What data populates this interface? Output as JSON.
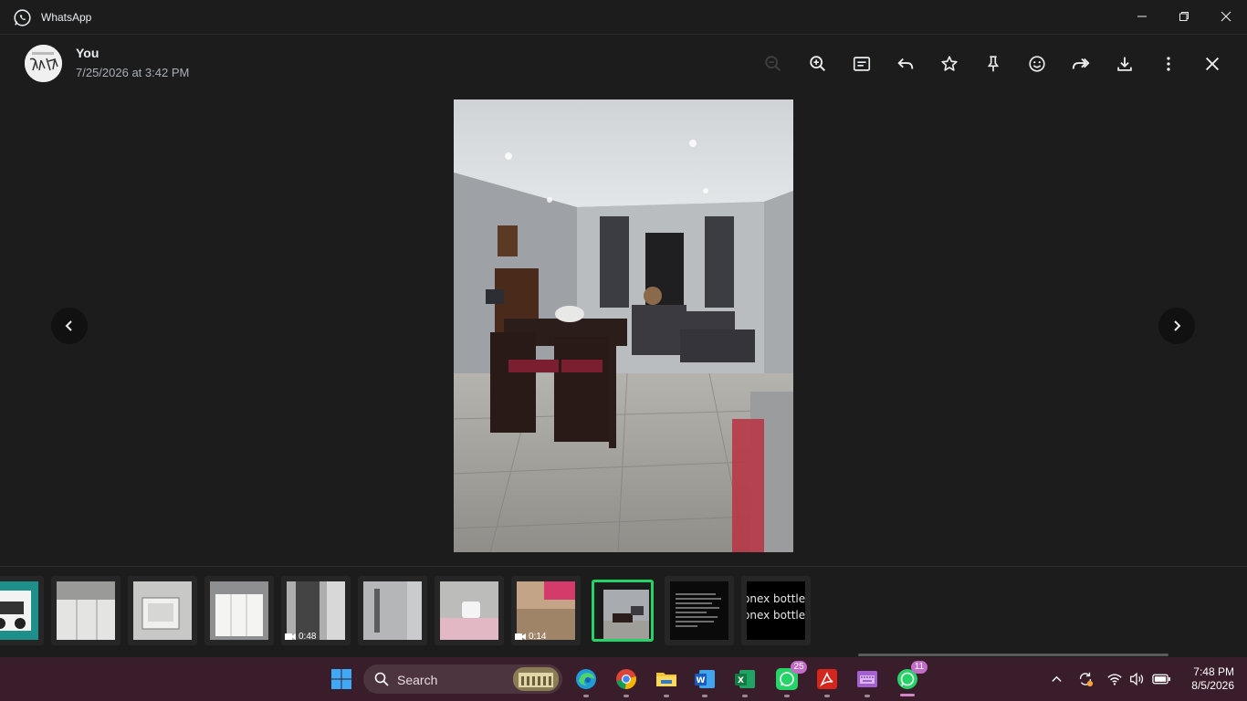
{
  "window": {
    "title": "WhatsApp"
  },
  "header": {
    "sender": "You",
    "timestamp": "7/25/2026 at 3:42 PM"
  },
  "toolbar": {
    "icons": [
      "zoom-out-icon",
      "zoom-in-icon",
      "caption-icon",
      "reply-icon",
      "star-icon",
      "pin-icon",
      "emoji-icon",
      "forward-icon",
      "download-icon",
      "more-icon",
      "close-icon"
    ]
  },
  "thumbnails": [
    {
      "kind": "image",
      "label": ""
    },
    {
      "kind": "image",
      "label": ""
    },
    {
      "kind": "image",
      "label": ""
    },
    {
      "kind": "image",
      "label": ""
    },
    {
      "kind": "video",
      "label": "0:48"
    },
    {
      "kind": "image",
      "label": ""
    },
    {
      "kind": "image",
      "label": ""
    },
    {
      "kind": "video",
      "label": "0:14"
    },
    {
      "kind": "image",
      "label": "",
      "selected": true
    },
    {
      "kind": "document",
      "label": ""
    },
    {
      "kind": "text",
      "line1": "onex bottle",
      "line2": "onex bottle"
    }
  ],
  "taskbar": {
    "search_label": "Search",
    "whatsapp_badge": "25",
    "whatsapp_active_badge": "11",
    "time": "7:48 PM",
    "date": "8/5/2026"
  },
  "colors": {
    "accent": "#25d366",
    "background": "#1c1c1c",
    "taskbar": "#3a1d2a"
  }
}
